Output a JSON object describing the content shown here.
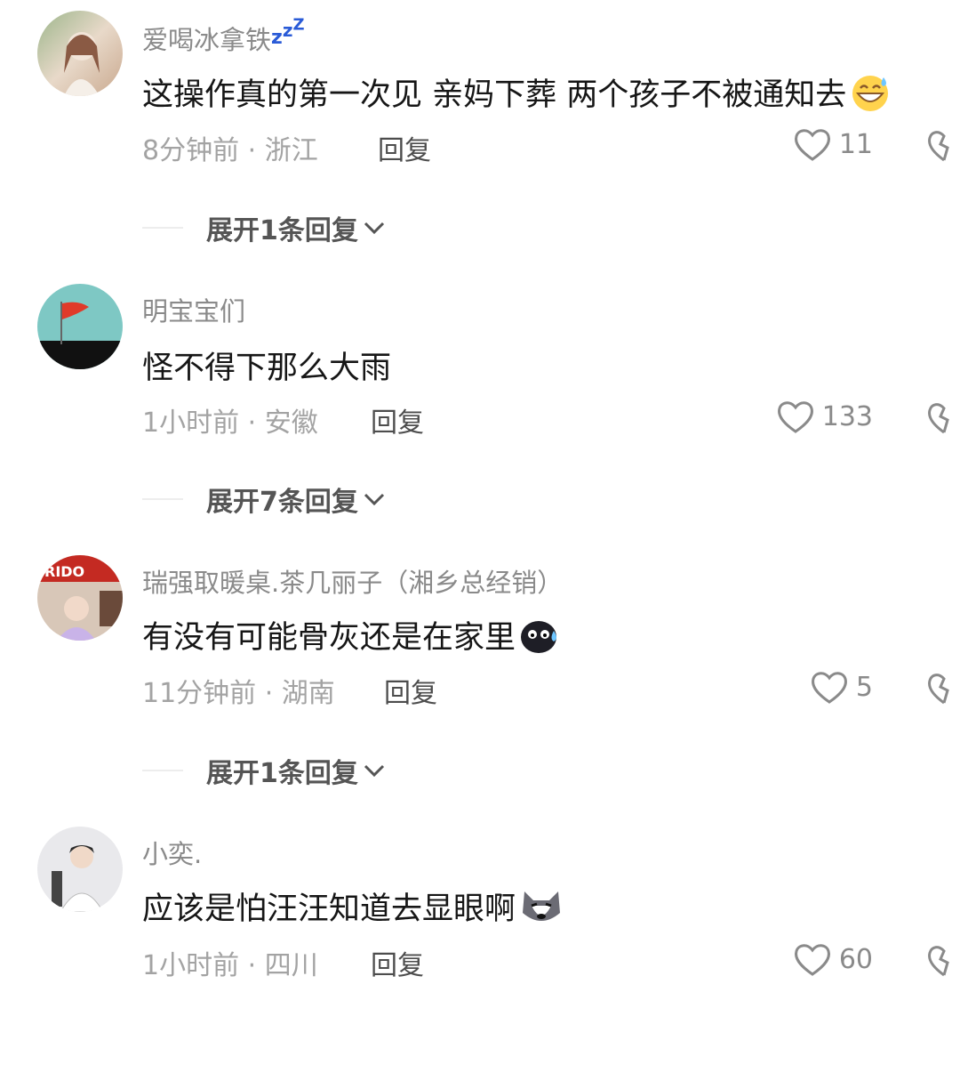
{
  "comments": [
    {
      "username": "爱喝冰拿铁",
      "username_badge_icon": "zzz-sleep-icon",
      "text": "这操作真的第一次见 亲妈下葬 两个孩子不被通知去",
      "emoji": "grinning-sweat-emoji",
      "time_location": "8分钟前 · 浙江",
      "reply_label": "回复",
      "likes": "11",
      "expand_label": "展开1条回复"
    },
    {
      "username": "明宝宝们",
      "text": "怪不得下那么大雨",
      "time_location": "1小时前 · 安徽",
      "reply_label": "回复",
      "likes": "133",
      "expand_label": "展开7条回复"
    },
    {
      "username": "瑞强取暖桌.茶几丽子（湘乡总经销）",
      "text": "有没有可能骨灰还是在家里",
      "emoji": "black-blob-sweat-emoji",
      "time_location": "11分钟前 · 湖南",
      "reply_label": "回复",
      "likes": "5",
      "expand_label": "展开1条回复"
    },
    {
      "username": "小奕.",
      "text": "应该是怕汪汪知道去显眼啊",
      "emoji": "husky-dog-emoji",
      "time_location": "1小时前 · 四川",
      "reply_label": "回复",
      "likes": "60"
    }
  ],
  "colors": {
    "username": "#8a8a8a",
    "text": "#161616",
    "meta": "#a3a3a3",
    "reply": "#4d4d4d",
    "expand": "#555555"
  }
}
